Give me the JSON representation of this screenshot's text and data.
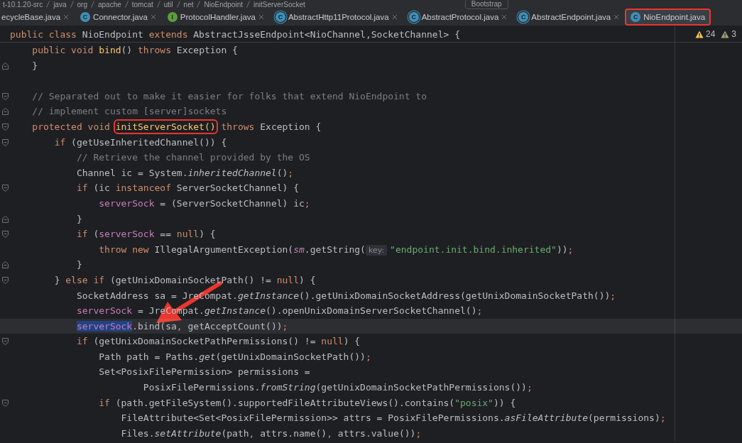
{
  "breadcrumbs": [
    "t-10.1.20-src",
    "java",
    "org",
    "apache",
    "tomcat",
    "util",
    "net",
    "NioEndpoint",
    "initServerSocket"
  ],
  "run_config": {
    "label": "Bootstrap"
  },
  "tabs": [
    {
      "label": "ecycleBase.java",
      "kind": "cut",
      "selected": false,
      "annotated": false
    },
    {
      "label": "Connector.java",
      "kind": "class",
      "icon_letter": "C",
      "selected": false,
      "annotated": false
    },
    {
      "label": "ProtocolHandler.java",
      "kind": "interface",
      "icon_letter": "I",
      "selected": false,
      "annotated": false
    },
    {
      "label": "AbstractHttp11Protocol.java",
      "kind": "abstract",
      "icon_letter": "C",
      "selected": false,
      "annotated": false
    },
    {
      "label": "AbstractProtocol.java",
      "kind": "abstract",
      "icon_letter": "C",
      "selected": false,
      "annotated": false
    },
    {
      "label": "AbstractEndpoint.java",
      "kind": "abstract",
      "icon_letter": "C",
      "selected": false,
      "annotated": false
    },
    {
      "label": "NioEndpoint.java",
      "kind": "class",
      "icon_letter": "C",
      "selected": true,
      "annotated": true
    }
  ],
  "sticky_header": [
    {
      "text": "public class",
      "kind": "keyword"
    },
    {
      "text": " NioEndpoint ",
      "kind": "plain"
    },
    {
      "text": "extends",
      "kind": "keyword"
    },
    {
      "text": " AbstractJsseEndpoint<NioChannel,SocketChannel> {",
      "kind": "plain"
    }
  ],
  "inspections": [
    {
      "kind": "warning",
      "count": "24"
    },
    {
      "kind": "weak",
      "count": "3"
    }
  ],
  "lines": [
    {
      "kind": "plain",
      "current": false,
      "tokens": [
        {
          "text": "    public void ",
          "kind": "keyword"
        },
        {
          "text": "bind",
          "kind": "decl"
        },
        {
          "text": "() ",
          "kind": "plain"
        },
        {
          "text": "throws",
          "kind": "keyword"
        },
        {
          "text": " Exception {",
          "kind": "plain"
        }
      ]
    },
    {
      "kind": "fold-close",
      "current": false,
      "tokens": [
        {
          "text": "    }",
          "kind": "plain"
        }
      ]
    },
    {
      "kind": "plain",
      "current": false
    },
    {
      "kind": "fold-open",
      "current": false,
      "tokens": [
        {
          "text": "    // Separated out to make it easier for folks that extend NioEndpoint to",
          "kind": "comment"
        }
      ]
    },
    {
      "kind": "fold-close",
      "current": false,
      "tokens": [
        {
          "text": "    // implement custom [server]sockets",
          "kind": "comment"
        }
      ]
    },
    {
      "kind": "fold-open",
      "current": false,
      "tokens": [
        {
          "text": "    protected void ",
          "kind": "keyword"
        },
        {
          "text": "initServerSocket()",
          "kind": "decl-marked"
        },
        {
          "text": " throws",
          "kind": "keyword"
        },
        {
          "text": " Exception {",
          "kind": "plain"
        }
      ]
    },
    {
      "kind": "fold-open",
      "current": false,
      "tokens": [
        {
          "text": "        if",
          "kind": "keyword"
        },
        {
          "text": " (getUseInheritedChannel()) {",
          "kind": "plain"
        }
      ]
    },
    {
      "kind": "plain",
      "current": false,
      "tokens": [
        {
          "text": "            // Retrieve the channel provided by the OS",
          "kind": "comment"
        }
      ]
    },
    {
      "kind": "plain",
      "current": false,
      "tokens": [
        {
          "text": "            Channel ic = System.",
          "kind": "plain"
        },
        {
          "text": "inheritedChannel",
          "kind": "call"
        },
        {
          "text": "()",
          "kind": "plain"
        },
        {
          "text": ";",
          "kind": "punct"
        }
      ]
    },
    {
      "kind": "fold-open",
      "current": false,
      "tokens": [
        {
          "text": "            if",
          "kind": "keyword"
        },
        {
          "text": " (ic ",
          "kind": "plain"
        },
        {
          "text": "instanceof",
          "kind": "keyword"
        },
        {
          "text": " ServerSocketChannel) {",
          "kind": "plain"
        }
      ]
    },
    {
      "kind": "plain",
      "current": false,
      "tokens": [
        {
          "text": "                serverSock",
          "kind": "field"
        },
        {
          "text": " = (ServerSocketChannel) ic",
          "kind": "plain"
        },
        {
          "text": ";",
          "kind": "punct"
        }
      ]
    },
    {
      "kind": "fold-close",
      "current": false,
      "tokens": [
        {
          "text": "            }",
          "kind": "plain"
        }
      ]
    },
    {
      "kind": "fold-open",
      "current": false,
      "tokens": [
        {
          "text": "            if",
          "kind": "keyword"
        },
        {
          "text": " (",
          "kind": "plain"
        },
        {
          "text": "serverSock",
          "kind": "field"
        },
        {
          "text": " == ",
          "kind": "plain"
        },
        {
          "text": "null",
          "kind": "keyword"
        },
        {
          "text": ") {",
          "kind": "plain"
        }
      ]
    },
    {
      "kind": "plain",
      "current": false,
      "tokens": [
        {
          "text": "                throw new",
          "kind": "keyword"
        },
        {
          "text": " IllegalArgumentException(",
          "kind": "plain"
        },
        {
          "text": "sm",
          "kind": "static-field"
        },
        {
          "text": ".getString(",
          "kind": "plain"
        },
        {
          "text": "key:",
          "kind": "hint"
        },
        {
          "text": "\"endpoint.init.bind.inherited\"",
          "kind": "string"
        },
        {
          "text": "))",
          "kind": "plain"
        },
        {
          "text": ";",
          "kind": "punct"
        }
      ]
    },
    {
      "kind": "fold-close",
      "current": false,
      "tokens": [
        {
          "text": "            }",
          "kind": "plain"
        }
      ]
    },
    {
      "kind": "fold-open",
      "current": false,
      "tokens": [
        {
          "text": "        } ",
          "kind": "plain"
        },
        {
          "text": "else if",
          "kind": "keyword"
        },
        {
          "text": " (getUnixDomainSocketPath() != ",
          "kind": "plain"
        },
        {
          "text": "null",
          "kind": "keyword"
        },
        {
          "text": ") {",
          "kind": "plain"
        }
      ]
    },
    {
      "kind": "plain",
      "current": false,
      "tokens": [
        {
          "text": "            SocketAddress sa = JreCompat.",
          "kind": "plain"
        },
        {
          "text": "getInstance",
          "kind": "call"
        },
        {
          "text": "().getUnixDomainSocketAddress(getUnixDomainSocketPath())",
          "kind": "plain"
        },
        {
          "text": ";",
          "kind": "punct"
        }
      ]
    },
    {
      "kind": "plain",
      "current": false,
      "tokens": [
        {
          "text": "            serverSock",
          "kind": "field"
        },
        {
          "text": " = JreCompat.",
          "kind": "plain"
        },
        {
          "text": "getInstance",
          "kind": "call"
        },
        {
          "text": "().openUnixDomainServerSocketChannel()",
          "kind": "plain"
        },
        {
          "text": ";",
          "kind": "punct"
        }
      ]
    },
    {
      "kind": "plain",
      "current": true,
      "tokens": [
        {
          "text": "            serverSock",
          "kind": "field-usage"
        },
        {
          "text": ".bind(sa",
          "kind": "plain"
        },
        {
          "text": ",",
          "kind": "punct"
        },
        {
          "text": " getAcceptCount())",
          "kind": "plain"
        },
        {
          "text": ";",
          "kind": "punct"
        }
      ]
    },
    {
      "kind": "fold-open",
      "current": false,
      "tokens": [
        {
          "text": "            if",
          "kind": "keyword"
        },
        {
          "text": " (getUnixDomainSocketPathPermissions() != ",
          "kind": "plain"
        },
        {
          "text": "null",
          "kind": "keyword"
        },
        {
          "text": ") {",
          "kind": "plain"
        }
      ]
    },
    {
      "kind": "plain",
      "current": false,
      "tokens": [
        {
          "text": "                Path path = Paths.",
          "kind": "plain"
        },
        {
          "text": "get",
          "kind": "call"
        },
        {
          "text": "(getUnixDomainSocketPath())",
          "kind": "plain"
        },
        {
          "text": ";",
          "kind": "punct"
        }
      ]
    },
    {
      "kind": "plain",
      "current": false,
      "tokens": [
        {
          "text": "                Set<PosixFilePermission> permissions =",
          "kind": "plain"
        }
      ]
    },
    {
      "kind": "plain",
      "current": false,
      "tokens": [
        {
          "text": "                        PosixFilePermissions.",
          "kind": "plain"
        },
        {
          "text": "fromString",
          "kind": "call"
        },
        {
          "text": "(getUnixDomainSocketPathPermissions())",
          "kind": "plain"
        },
        {
          "text": ";",
          "kind": "punct"
        }
      ]
    },
    {
      "kind": "fold-open",
      "current": false,
      "tokens": [
        {
          "text": "                if",
          "kind": "keyword"
        },
        {
          "text": " (path.getFileSystem().supportedFileAttributeViews().contains(",
          "kind": "plain"
        },
        {
          "text": "\"posix\"",
          "kind": "string"
        },
        {
          "text": ")) {",
          "kind": "plain"
        }
      ]
    },
    {
      "kind": "plain",
      "current": false,
      "tokens": [
        {
          "text": "                    FileAttribute<Set<PosixFilePermission>> attrs = PosixFilePermissions.",
          "kind": "plain"
        },
        {
          "text": "asFileAttribute",
          "kind": "call"
        },
        {
          "text": "(permissions)",
          "kind": "plain"
        },
        {
          "text": ";",
          "kind": "punct"
        }
      ]
    },
    {
      "kind": "plain",
      "current": false,
      "tokens": [
        {
          "text": "                    Files.",
          "kind": "plain"
        },
        {
          "text": "setAttribute",
          "kind": "call"
        },
        {
          "text": "(path",
          "kind": "plain"
        },
        {
          "text": ",",
          "kind": "punct"
        },
        {
          "text": " attrs.name()",
          "kind": "plain"
        },
        {
          "text": ",",
          "kind": "punct"
        },
        {
          "text": " attrs.value())",
          "kind": "plain"
        },
        {
          "text": ";",
          "kind": "punct"
        }
      ]
    }
  ]
}
